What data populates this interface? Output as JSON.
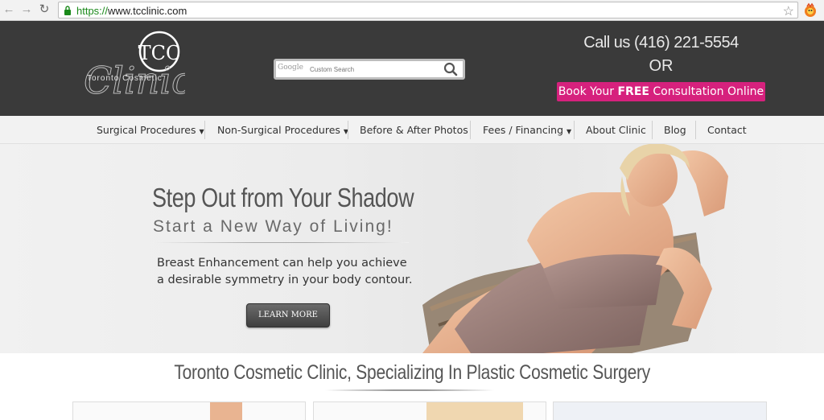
{
  "browser": {
    "url_scheme": "https://",
    "url_rest": "www.tcclinic.com"
  },
  "header": {
    "logo_initials": "TCC",
    "logo_script": "Clinic",
    "logo_text": "Toronto Cosmetic",
    "search_placeholder": "Custom Search",
    "search_brand": "Google",
    "call_text": "Call us (416) 221-5554",
    "or_text": "OR",
    "book_pre": "Book Your ",
    "book_bold": "FREE",
    "book_post": " Consultation Online",
    "book_color": "#d6217d"
  },
  "nav": {
    "items": [
      {
        "label": "Surgical Procedures",
        "dropdown": true
      },
      {
        "label": "Non-Surgical Procedures",
        "dropdown": true
      },
      {
        "label": "Before & After Photos",
        "dropdown": false
      },
      {
        "label": "Fees / Financing",
        "dropdown": true
      },
      {
        "label": "About Clinic",
        "dropdown": false
      },
      {
        "label": "Blog",
        "dropdown": false
      },
      {
        "label": "Contact",
        "dropdown": false
      }
    ]
  },
  "hero": {
    "title": "Step Out from Your Shadow",
    "subtitle": "Start a New Way of Living!",
    "body_line1": "Breast Enhancement can help you achieve",
    "body_line2": "a desirable symmetry in your body contour.",
    "cta_label": "LEARN MORE"
  },
  "main": {
    "tagline": "Toronto Cosmetic Clinic, Specializing In Plastic Cosmetic Surgery"
  }
}
